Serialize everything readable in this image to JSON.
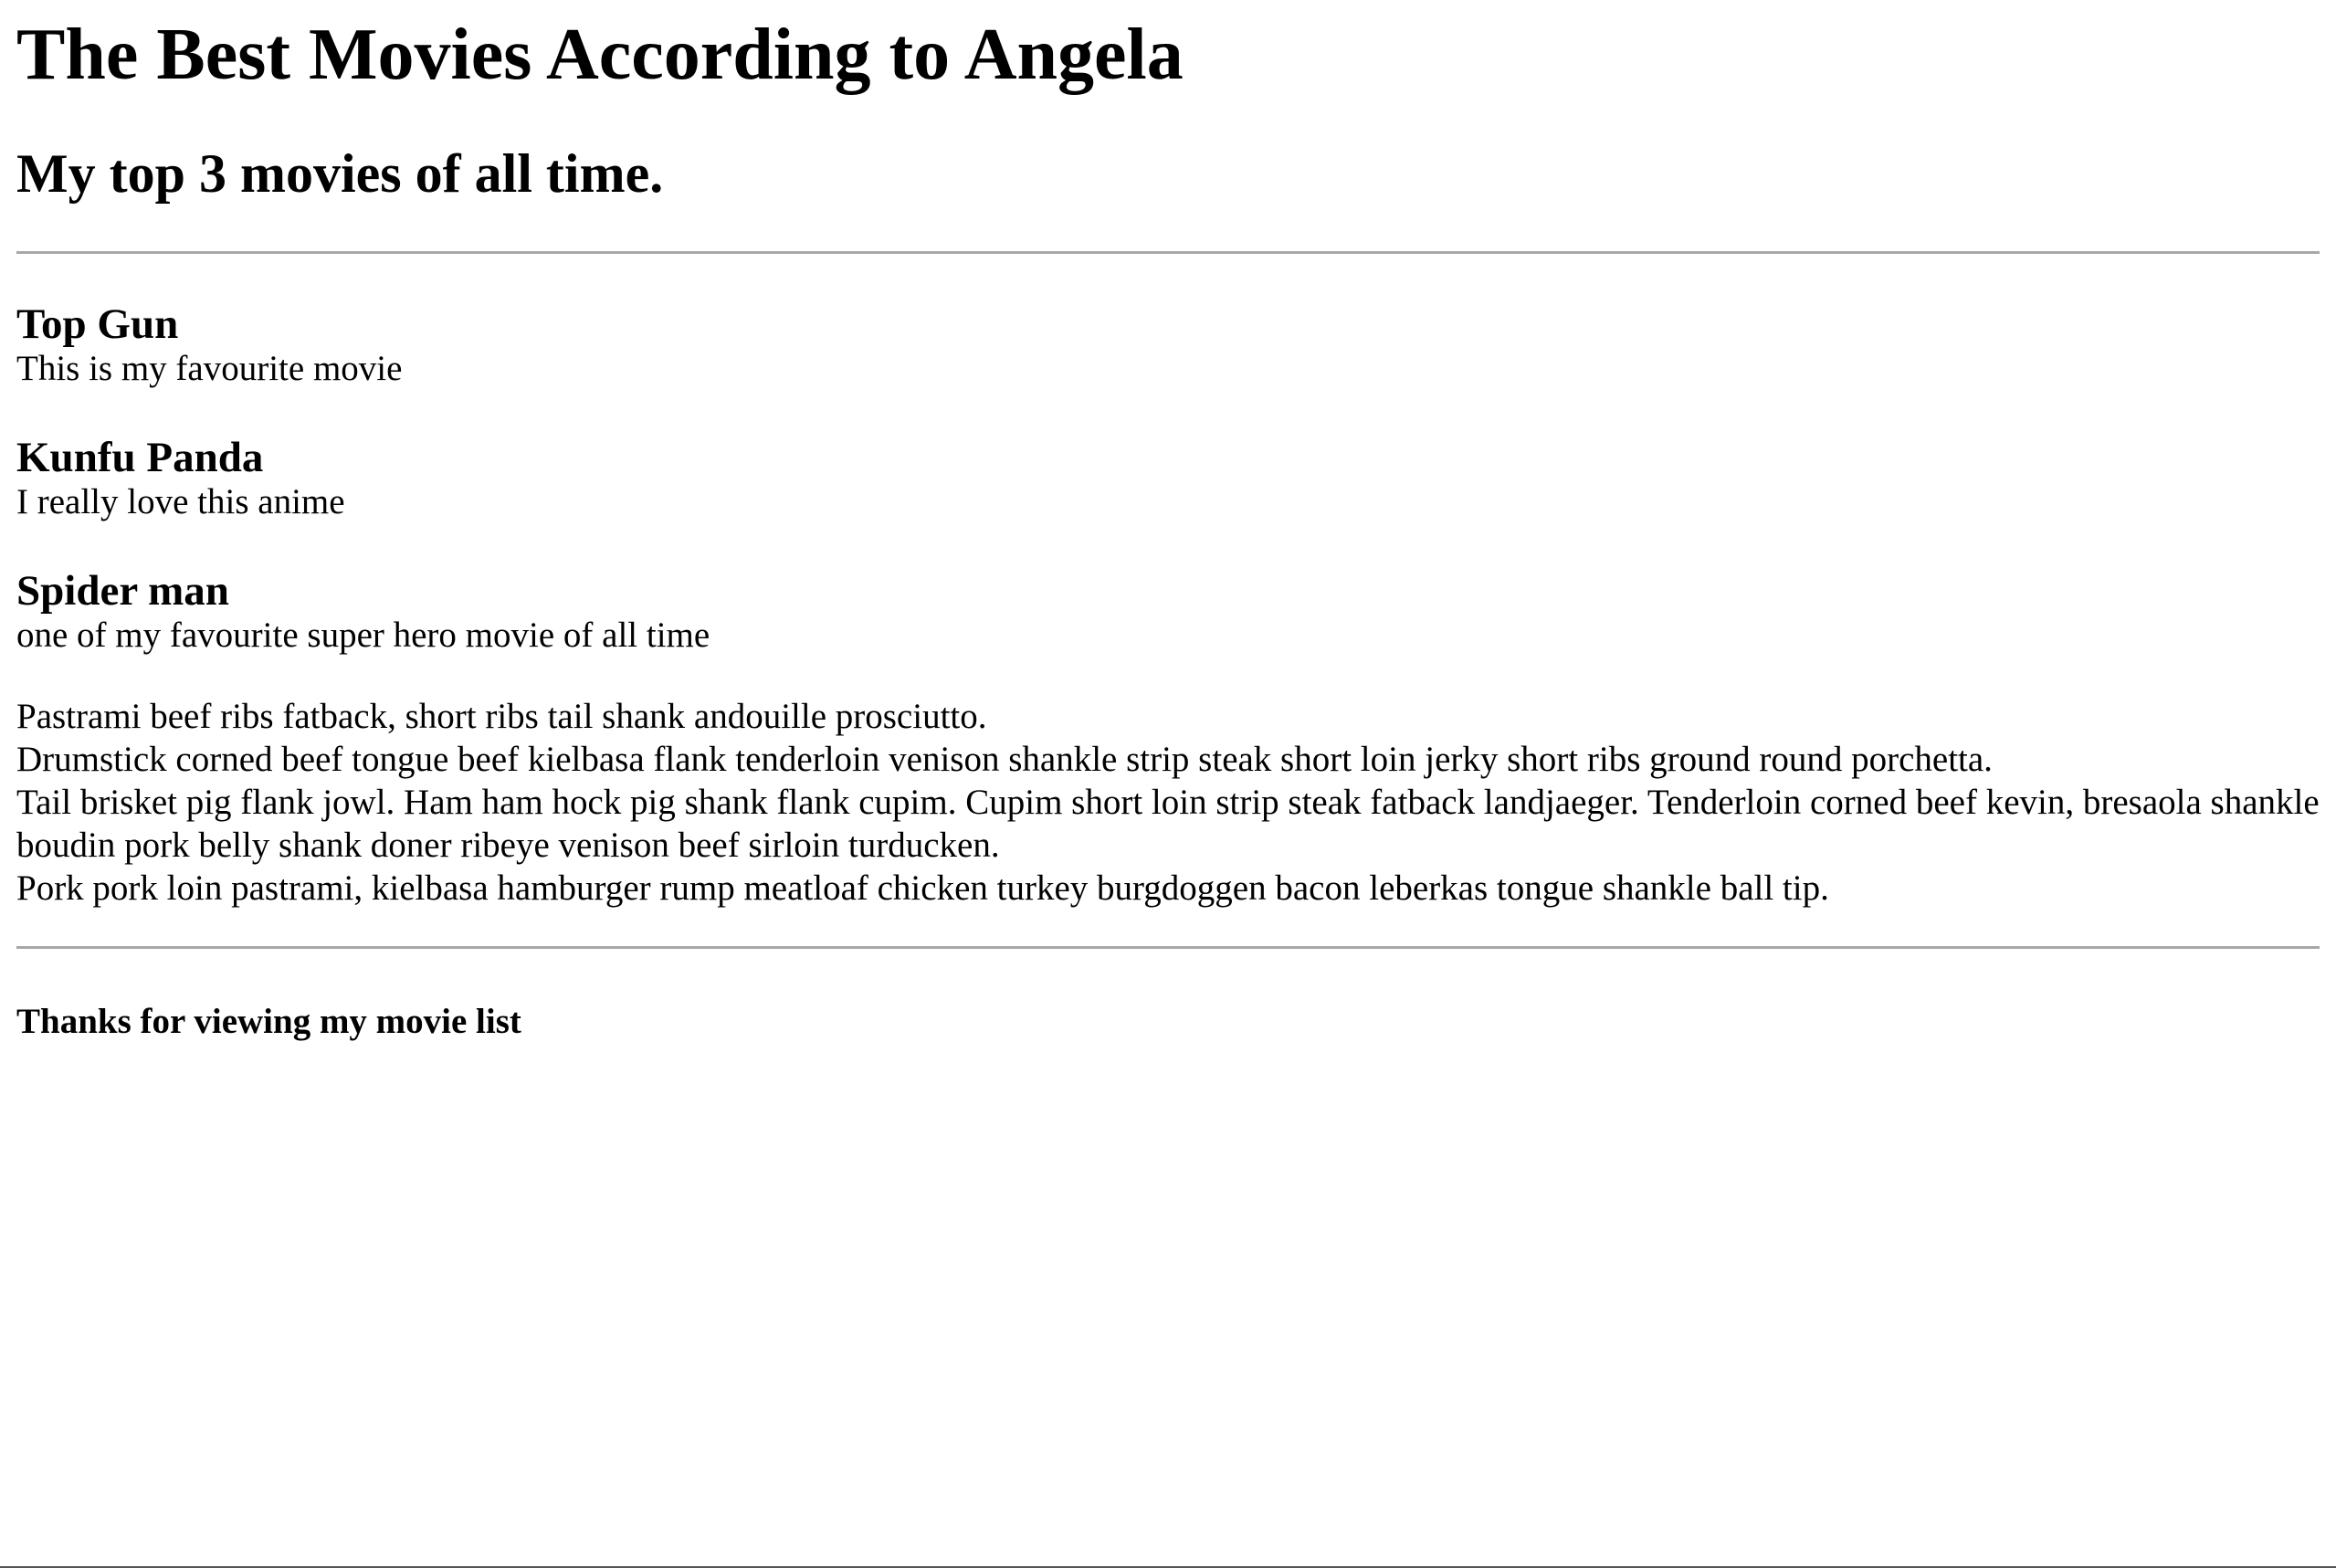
{
  "page": {
    "title": "The Best Movies According to Angela",
    "subtitle": "My top 3 movies of all time.",
    "movies": [
      {
        "title": "Top Gun",
        "description": "This is my favourite movie"
      },
      {
        "title": "Kunfu Panda",
        "description": "I really love this anime"
      },
      {
        "title": "Spider man",
        "description": "one of my favourite super hero movie of all time"
      }
    ],
    "filler_lines": [
      "Pastrami beef ribs fatback, short ribs tail shank andouille prosciutto.",
      "Drumstick corned beef tongue beef kielbasa flank tenderloin venison shankle strip steak short loin jerky short ribs ground round porchetta.",
      "Tail brisket pig flank jowl. Ham ham hock pig shank flank cupim. Cupim short loin strip steak fatback landjaeger. Tenderloin corned beef kevin, bresaola shankle boudin pork belly shank doner ribeye venison beef sirloin turducken.",
      "Pork pork loin pastrami, kielbasa hamburger rump meatloaf chicken turkey burgdoggen bacon leberkas tongue shankle ball tip."
    ],
    "footer": "Thanks for viewing my movie list"
  }
}
